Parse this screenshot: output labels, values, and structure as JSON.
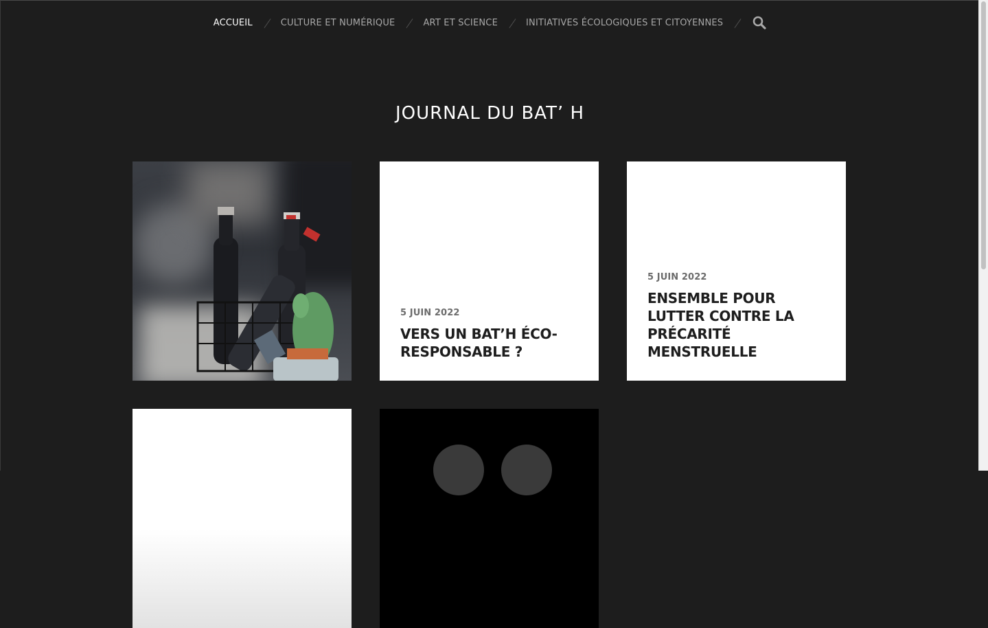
{
  "nav": {
    "items": [
      {
        "label": "Accueil",
        "active": true
      },
      {
        "label": "Culture et numérique",
        "active": false
      },
      {
        "label": "Art et science",
        "active": false
      },
      {
        "label": "Initiatives écologiques et citoyennes",
        "active": false
      }
    ],
    "search_icon": "search-icon"
  },
  "site": {
    "title": "JOURNAL DU BAT’ H"
  },
  "posts": [
    {
      "type": "image",
      "image": "photo of bottles in a wire basket with small cactus"
    },
    {
      "type": "text",
      "date": "5 juin 2022",
      "title": "Vers un Bat’h éco-responsable ?"
    },
    {
      "type": "text",
      "date": "5 juin 2022",
      "title": "Ensemble pour lutter contre la précarité menstruelle"
    },
    {
      "type": "text-partial"
    },
    {
      "type": "image-partial",
      "image": "dark image with two grey circles"
    }
  ],
  "colors": {
    "background": "#1d1d1d",
    "nav_text": "#a9a9a9",
    "nav_active": "#ffffff",
    "card_bg": "#ffffff",
    "card_text": "#1d1d1d",
    "date_text": "#6b6b6b"
  }
}
